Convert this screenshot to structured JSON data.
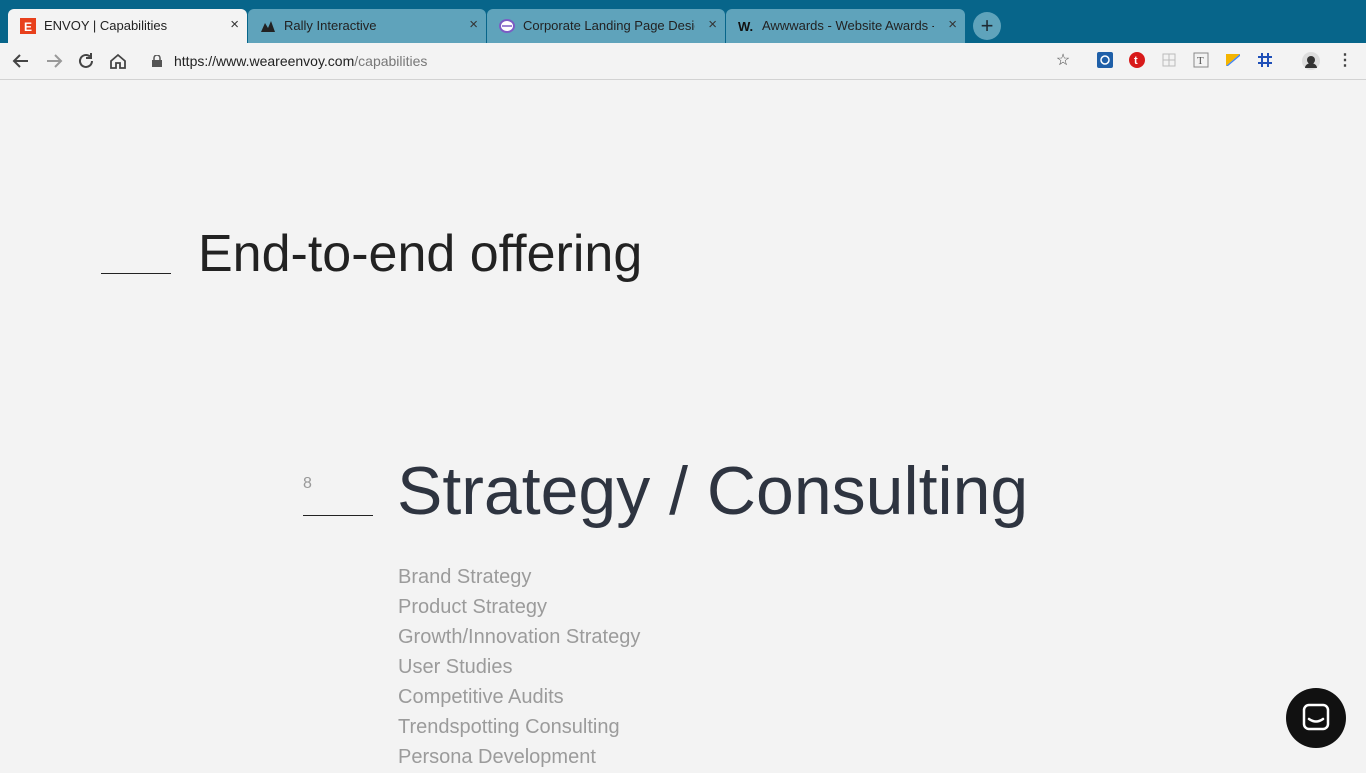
{
  "browser": {
    "tabs": [
      {
        "title": "ENVOY | Capabilities",
        "favicon": "envoy-e-icon",
        "close": "×"
      },
      {
        "title": "Rally Interactive",
        "favicon": "rally-icon",
        "close": "×"
      },
      {
        "title": "Corporate Landing Page Desig",
        "favicon": "dribbble-icon",
        "close": "×"
      },
      {
        "title": "Awwwards - Website Awards -",
        "favicon": "awwwards-w-icon",
        "close": "×"
      }
    ],
    "new_tab": "+",
    "url_host": "https://www.weareenvoy.com",
    "url_path": "/capabilities"
  },
  "page": {
    "heading": "End-to-end offering",
    "section_number": "8",
    "section_title": "Strategy / Consulting",
    "services": [
      "Brand Strategy",
      "Product Strategy",
      "Growth/Innovation Strategy",
      "User Studies",
      "Competitive Audits",
      "Trendspotting Consulting",
      "Persona Development"
    ]
  },
  "colors": {
    "tabstrip": "#07658a",
    "page_bg": "#f3f3f3",
    "heading": "#222222",
    "section_title": "#2e3440",
    "service_text": "#9b9b9b"
  }
}
